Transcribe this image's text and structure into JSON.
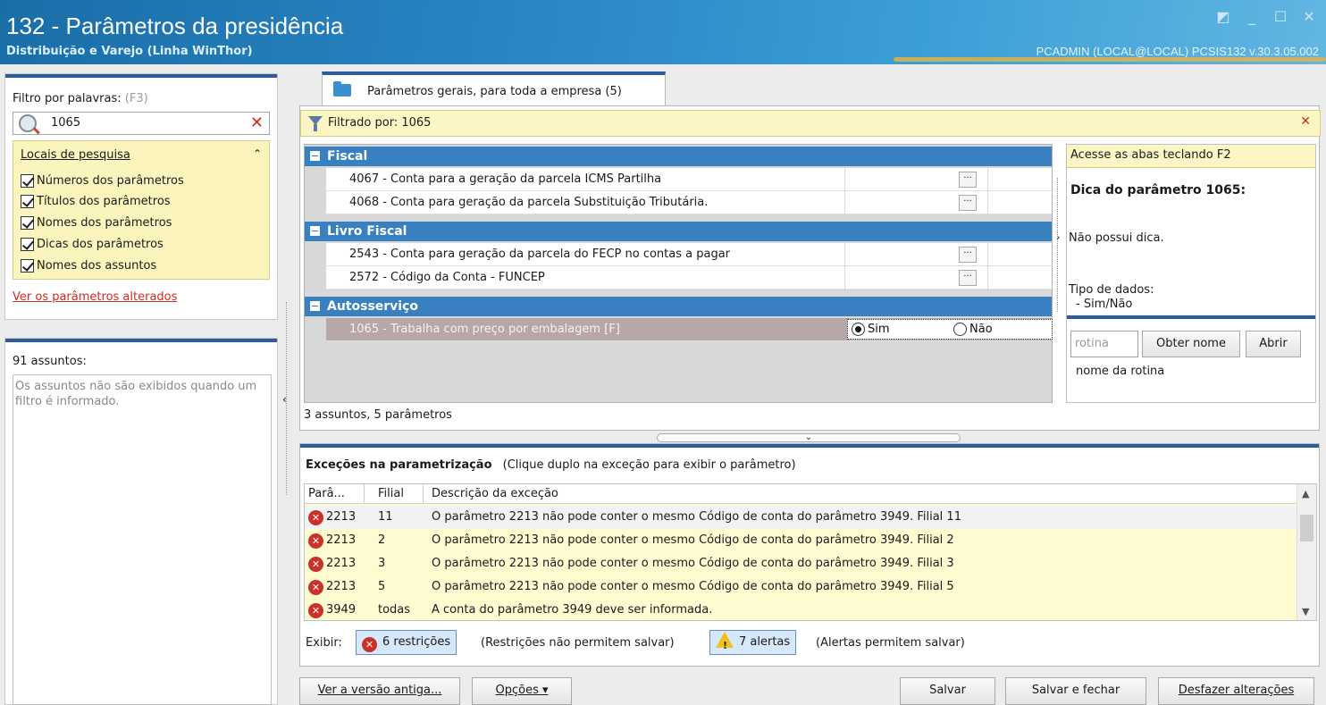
{
  "window": {
    "title": "132 - Parâmetros da presidência",
    "subtitle": "Distribuição e Varejo (Linha WinThor)",
    "session_info": "PCADMIN (LOCAL@LOCAL)   PCSIS132  v.30.3.05.002"
  },
  "filter": {
    "label": "Filtro por palavras:",
    "shortcut": "(F3)",
    "search_value": "1065",
    "locais_title": "Locais de pesquisa",
    "options": [
      "Números dos parâmetros",
      "Títulos dos parâmetros",
      "Nomes dos parâmetros",
      "Dicas dos parâmetros",
      "Nomes dos assuntos"
    ],
    "changed_link": "Ver os parâmetros alterados"
  },
  "assuntos": {
    "count": "91 assuntos:",
    "message": "Os assuntos não são exibidos quando um filtro é informado."
  },
  "tab": {
    "label": "Parâmetros gerais, para toda a empresa  (5)"
  },
  "filtrado": {
    "text": "Filtrado por: 1065"
  },
  "groups": [
    {
      "name": "Fiscal",
      "params": [
        "4067 - Conta para a geração da parcela ICMS Partilha",
        "4068 - Conta para geração da parcela Substituição Tributária."
      ]
    },
    {
      "name": "Livro Fiscal",
      "params": [
        "2543 - Conta para geração da parcela do FECP no contas a pagar",
        "2572 - Código da Conta - FUNCEP"
      ]
    },
    {
      "name": "Autosserviço",
      "params": [
        "1065 - Trabalha com preço por embalagem [F]"
      ]
    }
  ],
  "radio": {
    "sim": "Sim",
    "nao": "Não",
    "selected": "Sim"
  },
  "grid_summary": "3 assuntos, 5 parâmetros",
  "side": {
    "tip": "Acesse as abas teclando F2",
    "heading": "Dica do parâmetro 1065:",
    "no_tip": "Não possui dica.",
    "type_label": "Tipo de dados:",
    "type_value": "- Sim/Não",
    "rotina_placeholder": "rotina",
    "obter_nome": "Obter nome",
    "abrir": "Abrir",
    "nome_rotina": "nome da rotina"
  },
  "exceptions": {
    "title": "Exceções na parametrização",
    "hint": "(Clique duplo na exceção para exibir o parâmetro)",
    "columns": [
      "Parâ...",
      "Filial",
      "Descrição da exceção"
    ],
    "rows": [
      {
        "param": "2213",
        "filial": "11",
        "desc": "O parâmetro 2213 não pode conter o mesmo Código de conta do parâmetro 3949. Filial 11"
      },
      {
        "param": "2213",
        "filial": "2",
        "desc": "O parâmetro 2213 não pode conter o mesmo Código de conta do parâmetro 3949. Filial 2"
      },
      {
        "param": "2213",
        "filial": "3",
        "desc": "O parâmetro 2213 não pode conter o mesmo Código de conta do parâmetro 3949. Filial 3"
      },
      {
        "param": "2213",
        "filial": "5",
        "desc": "O parâmetro 2213 não pode conter o mesmo Código de conta do parâmetro 3949. Filial 5"
      },
      {
        "param": "3949",
        "filial": "todas",
        "desc": "A conta do parâmetro 3949 deve ser informada."
      }
    ],
    "exibir": "Exibir:",
    "restricoes": "6 restrições",
    "restricoes_note": "(Restrições não permitem salvar)",
    "alertas": "7 alertas",
    "alertas_note": "(Alertas permitem salvar)"
  },
  "buttons": {
    "versao_antiga": "Ver a versão antiga...",
    "opcoes": "Opções ▾",
    "salvar": "Salvar",
    "salvar_fechar": "Salvar e fechar",
    "desfazer": "Desfazer alterações"
  }
}
